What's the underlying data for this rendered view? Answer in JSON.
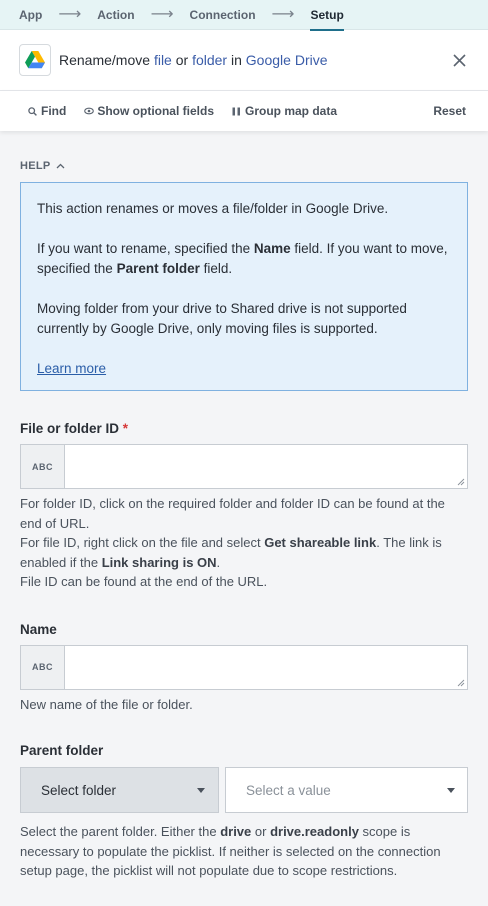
{
  "breadcrumb": {
    "steps": [
      "App",
      "Action",
      "Connection",
      "Setup"
    ],
    "separator": "⟶"
  },
  "header": {
    "title_parts": [
      "Rename/move ",
      "file",
      " or ",
      "folder",
      " in ",
      "Google Drive"
    ],
    "app_icon": "google-drive-icon",
    "close_icon": "close-icon"
  },
  "toolbar": {
    "find": "Find",
    "show_optional": "Show optional fields",
    "group_map": "Group map data",
    "reset": "Reset"
  },
  "help": {
    "toggle": "HELP",
    "p1": "This action renames or moves a file/folder in Google Drive.",
    "p2_a": "If you want to rename, specified the ",
    "p2_b": "Name",
    "p2_c": " field. If you want to move, specified the ",
    "p2_d": "Parent folder",
    "p2_e": " field.",
    "p3": "Moving folder from your drive to Shared drive is not supported currently by Google Drive, only moving files is supported.",
    "learn_more": "Learn more"
  },
  "fields": {
    "file_id": {
      "label": "File or folder ID",
      "required_mark": "*",
      "type_badge": "ABC",
      "value": "",
      "hint_1": "For folder ID, click on the required folder and folder ID can be found at the end of URL.",
      "hint_2a": "For file ID, right click on the file and select ",
      "hint_2b": "Get shareable link",
      "hint_2c": ". The link is enabled if the ",
      "hint_2d": "Link sharing is ON",
      "hint_2e": ".",
      "hint_3": "File ID can be found at the end of the URL."
    },
    "name": {
      "label": "Name",
      "type_badge": "ABC",
      "value": "",
      "hint": "New name of the file or folder."
    },
    "parent_folder": {
      "label": "Parent folder",
      "mode_select": "Select folder",
      "value_placeholder": "Select a value",
      "hint_a": "Select the parent folder. Either the ",
      "hint_b": "drive",
      "hint_c": " or ",
      "hint_d": "drive.readonly",
      "hint_e": " scope is necessary to populate the picklist. If neither is selected on the connection setup page, the picklist will not populate due to scope restrictions."
    }
  },
  "colors": {
    "breadcrumb_bg": "#e6f4f5",
    "help_bg": "#e5f1fb",
    "help_border": "#7fb1e0",
    "link": "#3a5ca8",
    "required": "#d63838"
  }
}
